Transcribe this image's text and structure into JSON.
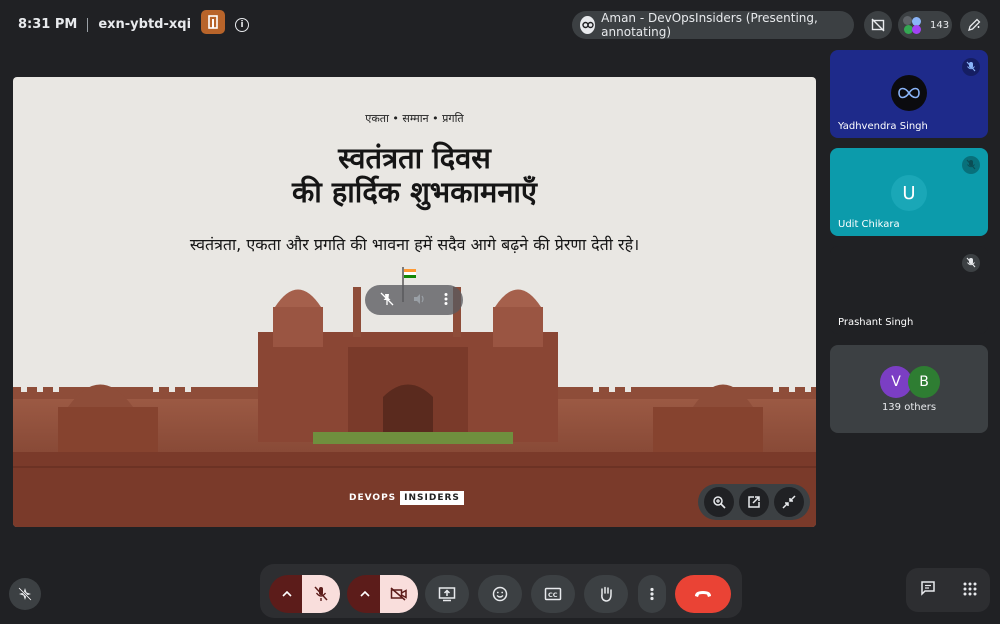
{
  "topbar": {
    "time": "8:31 PM",
    "meeting_code": "exn-ybtd-xqi",
    "presenting_label": "Aman - DevOpsInsiders (Presenting, annotating)",
    "participant_count": "143"
  },
  "slide": {
    "kicker": "एकता • सम्मान • प्रगति",
    "title_line1": "स्वतंत्रता दिवस",
    "title_line2": "की हार्दिक शुभकामनाएँ",
    "subtitle": "स्वतंत्रता, एकता और प्रगति की भावना हमें सदैव आगे बढ़ने की प्रेरणा देती रहे।",
    "brand_left": "DEVOPS",
    "brand_right": "INSIDERS"
  },
  "participants": [
    {
      "name": "Yadhvendra Singh",
      "bg": "#1e2a8a"
    },
    {
      "name": "Udit Chikara",
      "initial": "U",
      "bg": "#0c9bab",
      "avatar_bg": "#1aa7b7"
    },
    {
      "name": "Prashant Singh",
      "bg": "#202124"
    }
  ],
  "others": {
    "label": "139 others",
    "avatars": [
      {
        "initial": "V",
        "color": "#7b3ec4"
      },
      {
        "initial": "B",
        "color": "#2e7d32"
      }
    ]
  },
  "colors": {
    "accent_red": "#ea4335",
    "off_button_bg": "#f9dedc",
    "bar_bg": "#2d2e31"
  },
  "icons": {
    "mic": "mic-off-icon",
    "camera": "camera-off-icon",
    "present": "present-icon",
    "emoji": "emoji-icon",
    "captions": "captions-icon",
    "hand": "raise-hand-icon",
    "more": "more-vert-icon",
    "end": "end-call-icon"
  }
}
